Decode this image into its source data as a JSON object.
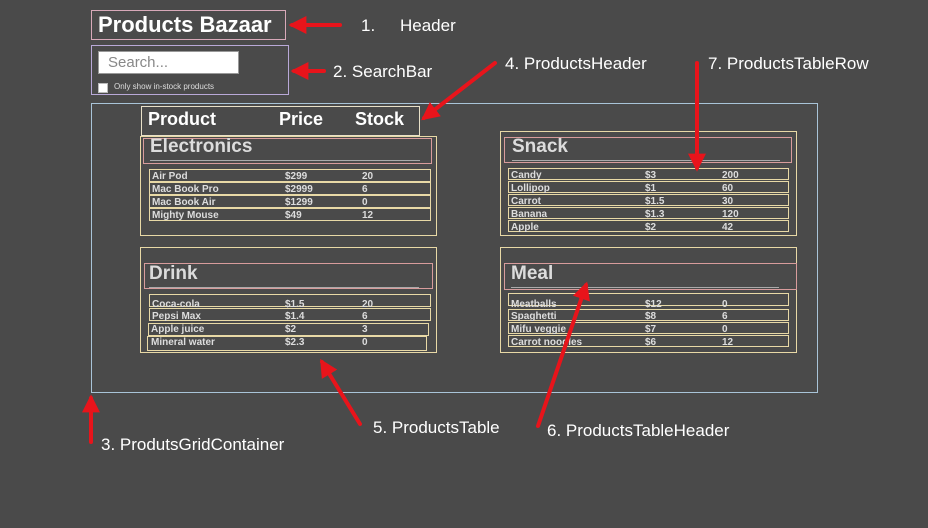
{
  "header": {
    "title": "Products Bazaar"
  },
  "search": {
    "placeholder": "Search...",
    "checkbox_label": "Only show in-stock products"
  },
  "products_header": {
    "columns": [
      "Product",
      "Price",
      "Stock"
    ]
  },
  "tables": [
    {
      "category": "Electronics",
      "rows": [
        [
          "Air Pod",
          "$299",
          "20"
        ],
        [
          "Mac Book Pro",
          "$2999",
          "6"
        ],
        [
          "Mac Book Air",
          "$1299",
          "0"
        ],
        [
          "Mighty Mouse",
          "$49",
          "12"
        ]
      ]
    },
    {
      "category": "Snack",
      "rows": [
        [
          "Candy",
          "$3",
          "200"
        ],
        [
          "Lollipop",
          "$1",
          "60"
        ],
        [
          "Carrot",
          "$1.5",
          "30"
        ],
        [
          "Banana",
          "$1.3",
          "120"
        ],
        [
          "Apple",
          "$2",
          "42"
        ]
      ]
    },
    {
      "category": "Drink",
      "rows": [
        [
          "Coca-cola",
          "$1.5",
          "20"
        ],
        [
          "Pepsi Max",
          "$1.4",
          "6"
        ],
        [
          "Apple juice",
          "$2",
          "3"
        ],
        [
          "Mineral water",
          "$2.3",
          "0"
        ]
      ]
    },
    {
      "category": "Meal",
      "rows": [
        [
          "Meatballs",
          "$12",
          "0"
        ],
        [
          "Spaghetti",
          "$8",
          "6"
        ],
        [
          "Mifu veggie",
          "$7",
          "0"
        ],
        [
          "Carrot noodles",
          "$6",
          "12"
        ]
      ]
    }
  ],
  "annotations": {
    "header_num": "1.",
    "header": "Header",
    "searchbar": "2. SearchBar",
    "grid": "3. ProdutsGridContainer",
    "products_header": "4. ProductsHeader",
    "products_table": "5. ProductsTable",
    "table_header": "6. ProductsTableHeader",
    "table_row": "7. ProductsTableRow"
  },
  "colors": {
    "background": "#4a4a4a",
    "arrow": "#e8141b",
    "row_border": "#e8d9a6",
    "header_border": "#d89c9c"
  }
}
